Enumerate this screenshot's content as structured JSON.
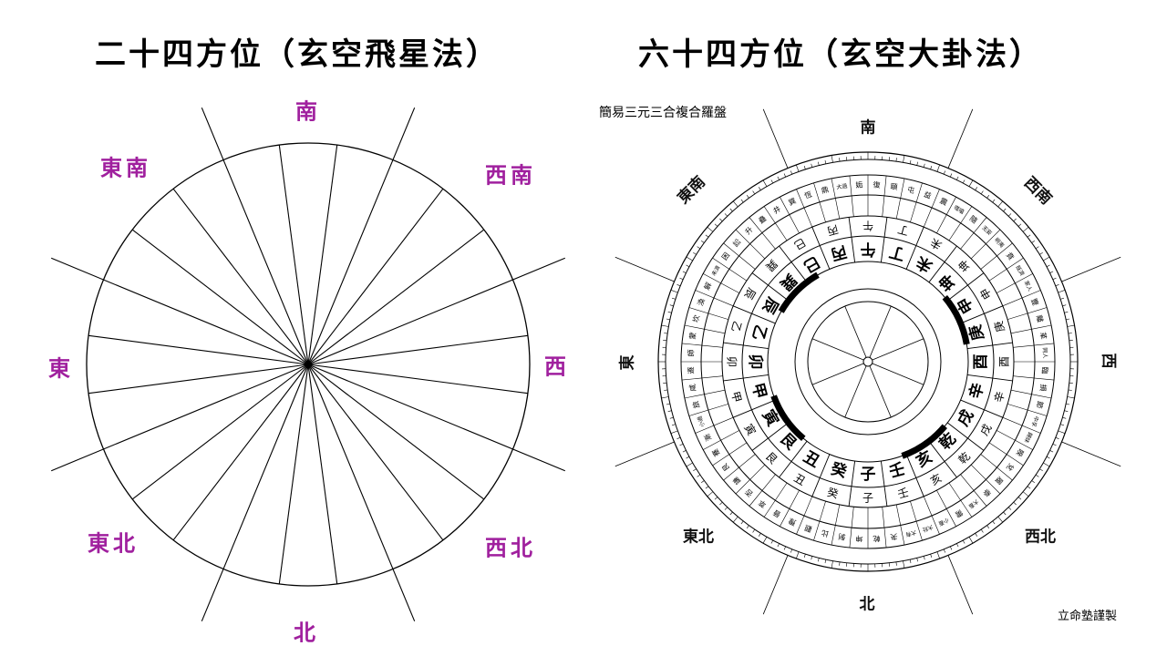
{
  "left": {
    "title": "二十四方位（玄空飛星法）",
    "directions": {
      "south": "南",
      "southeast": "東南",
      "southwest": "西南",
      "east": "東",
      "west": "西",
      "northeast": "東北",
      "northwest": "西北",
      "north": "北"
    },
    "sectors": 24,
    "line_color": "#000000",
    "label_color": "#a0209e"
  },
  "right": {
    "title": "六十四方位（玄空大卦法）",
    "compass_caption": "簡易三元三合複合羅盤",
    "maker_credit": "立命塾謹製",
    "directions": {
      "south": "南",
      "southeast": "東南",
      "southwest": "西南",
      "east": "東",
      "west": "西",
      "northeast": "東北",
      "northwest": "西北",
      "north": "北"
    },
    "mountains_24": [
      "子",
      "癸",
      "丑",
      "艮",
      "寅",
      "甲",
      "卯",
      "乙",
      "辰",
      "巽",
      "巳",
      "丙",
      "午",
      "丁",
      "未",
      "坤",
      "申",
      "庚",
      "酉",
      "辛",
      "戌",
      "乾",
      "亥",
      "壬"
    ],
    "hexagrams_64": [
      "坤",
      "剝",
      "比",
      "觀",
      "豫",
      "晉",
      "萃",
      "否",
      "謙",
      "艮",
      "蹇",
      "漸",
      "小過",
      "旅",
      "咸",
      "遯",
      "師",
      "蒙",
      "坎",
      "渙",
      "解",
      "未濟",
      "困",
      "訟",
      "升",
      "蠱",
      "井",
      "巽",
      "恆",
      "鼎",
      "大過",
      "姤",
      "復",
      "頤",
      "屯",
      "益",
      "震",
      "噬嗑",
      "隨",
      "无妄",
      "明夷",
      "賁",
      "既濟",
      "家人",
      "豐",
      "離",
      "革",
      "同人",
      "臨",
      "損",
      "節",
      "中孚",
      "歸妹",
      "睽",
      "兌",
      "履",
      "泰",
      "大畜",
      "需",
      "小畜",
      "大壯",
      "大有",
      "夬",
      "乾"
    ]
  }
}
